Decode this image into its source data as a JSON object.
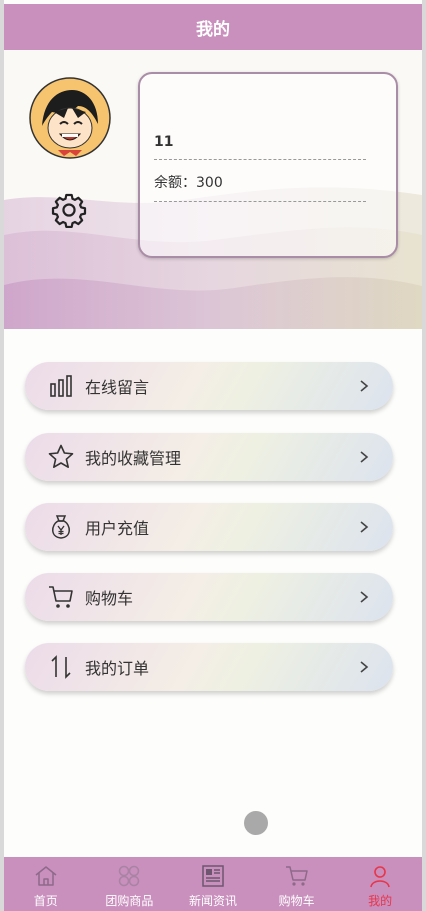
{
  "header": {
    "title": "我的"
  },
  "profile": {
    "username": "11",
    "balance_label": "余额",
    "balance_value": "300",
    "balance_text": "余额：300",
    "avatar_icon": "cartoon-avatar-icon",
    "settings_icon": "gear-icon"
  },
  "menu": [
    {
      "label": "在线留言",
      "icon": "bar-chart-icon"
    },
    {
      "label": "我的收藏管理",
      "icon": "star-icon"
    },
    {
      "label": "用户充值",
      "icon": "money-bag-icon"
    },
    {
      "label": "购物车",
      "icon": "cart-icon"
    },
    {
      "label": "我的订单",
      "icon": "sort-arrows-icon"
    }
  ],
  "tabs": [
    {
      "label": "首页",
      "icon": "home-icon",
      "active": false
    },
    {
      "label": "团购商品",
      "icon": "grid-icon",
      "active": false
    },
    {
      "label": "新闻资讯",
      "icon": "news-icon",
      "active": false
    },
    {
      "label": "购物车",
      "icon": "cart-icon",
      "active": false
    },
    {
      "label": "我的",
      "icon": "user-icon",
      "active": true
    }
  ],
  "colors": {
    "primary": "#c98fbd",
    "active_tab": "#e7364a"
  }
}
